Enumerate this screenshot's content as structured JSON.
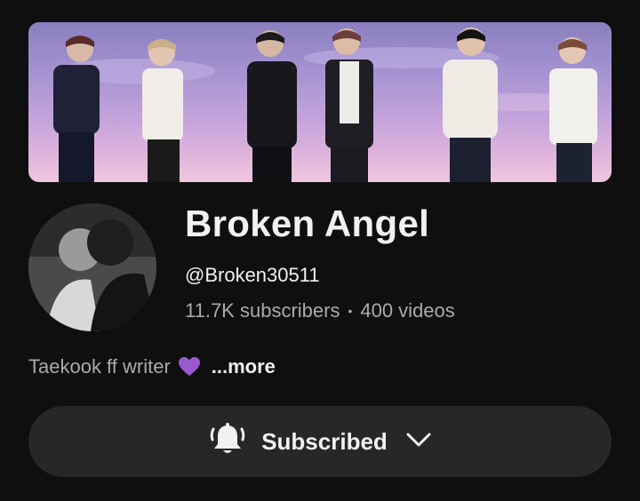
{
  "channel": {
    "name": "Broken Angel",
    "handle": "@Broken30511",
    "subscribers": "11.7K subscribers",
    "separator": "•",
    "videos": "400 videos",
    "description": "Taekook ff writer",
    "more_label": "...more"
  },
  "subscribe_button": {
    "label": "Subscribed",
    "icons": [
      "bell-ringing-icon",
      "chevron-down-icon"
    ]
  },
  "colors": {
    "background": "#0f0f0f",
    "button_bg": "#272727",
    "secondary_text": "#aaaaaa",
    "heart": "#9b59d0"
  }
}
